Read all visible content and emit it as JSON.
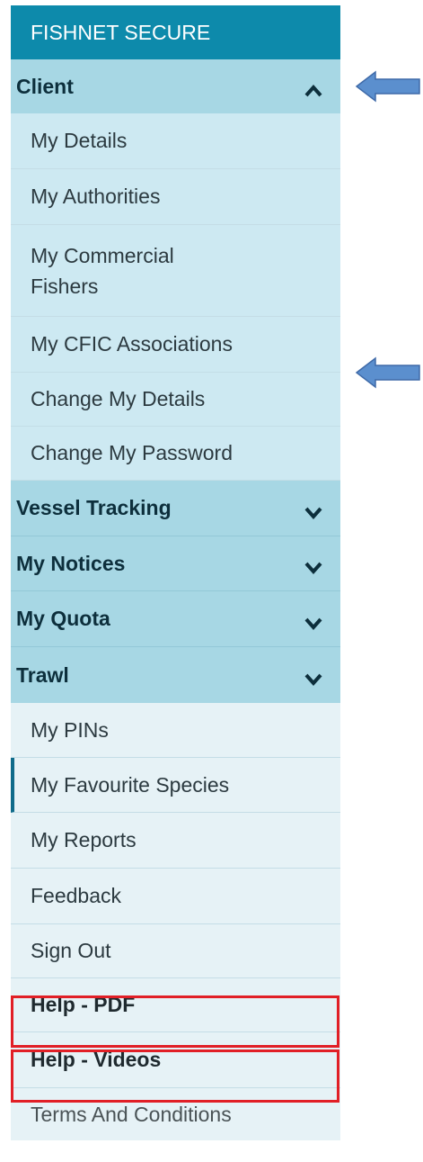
{
  "brand": {
    "title": "FISHNET SECURE"
  },
  "client": {
    "header": "Client",
    "items": [
      {
        "label": "My Details"
      },
      {
        "label": "My Authorities"
      },
      {
        "label": "My Commercial Fishers"
      },
      {
        "label": "My CFIC Associations"
      },
      {
        "label": "Change My Details"
      },
      {
        "label": "Change My Password"
      }
    ]
  },
  "sections": [
    {
      "label": "Vessel Tracking"
    },
    {
      "label": "My Notices"
    },
    {
      "label": "My Quota"
    },
    {
      "label": "Trawl"
    }
  ],
  "trawl": {
    "items": [
      {
        "label": "My PINs"
      },
      {
        "label": "My Favourite Species"
      },
      {
        "label": "My Reports"
      },
      {
        "label": "Feedback"
      },
      {
        "label": "Sign Out"
      },
      {
        "label": "Help - PDF"
      },
      {
        "label": "Help - Videos"
      },
      {
        "label": "Terms And Conditions"
      }
    ]
  },
  "colors": {
    "brand_bg": "#0d8aab",
    "section_bg": "#a7d7e4",
    "client_item_bg": "#cde9f2",
    "trawl_item_bg": "#e6f2f6",
    "highlight_border": "#e11f26",
    "arrow_fill": "#5b8fce"
  }
}
